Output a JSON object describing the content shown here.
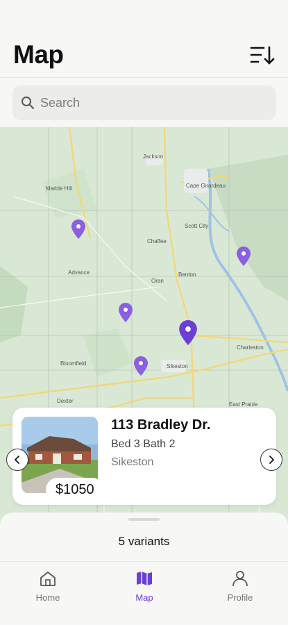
{
  "header": {
    "title": "Map",
    "sort_icon": "sort-descending-icon"
  },
  "search": {
    "placeholder": "Search",
    "value": ""
  },
  "map": {
    "labels": [
      "Jackson",
      "Cape Girardeau",
      "Marble Hill",
      "Scott City",
      "Chaffee",
      "Advance",
      "Oran",
      "Benton",
      "Charleston",
      "Bloomfield",
      "Sikeston",
      "Dexter",
      "East Prairie",
      "Dexter"
    ],
    "place_labels": {
      "jackson": "Jackson",
      "cape": "Cape Girardeau",
      "marble_hill": "Marble Hill",
      "scott_city": "Scott City",
      "chaffee": "Chaffee",
      "advance": "Advance",
      "oran": "Oran",
      "benton": "Benton",
      "charleston": "Charleston",
      "bloomfield": "Bloomfield",
      "sikeston": "Sikeston",
      "dexter": "Dexter",
      "east_prairie": "East Prairie"
    },
    "pin_color": "#8a5fe0",
    "selected_pin_color": "#6a3fd1"
  },
  "listing": {
    "address": "113 Bradley Dr.",
    "details": "Bed 3 Bath 2",
    "city": "Sikeston",
    "price": "$1050"
  },
  "sheet": {
    "variants_label": "5 variants"
  },
  "tabs": [
    {
      "label": "Home",
      "icon": "home-icon"
    },
    {
      "label": "Map",
      "icon": "map-icon"
    },
    {
      "label": "Profile",
      "icon": "person-icon"
    }
  ],
  "colors": {
    "accent": "#6a3fd1",
    "map_bg": "#d9e8d5"
  }
}
